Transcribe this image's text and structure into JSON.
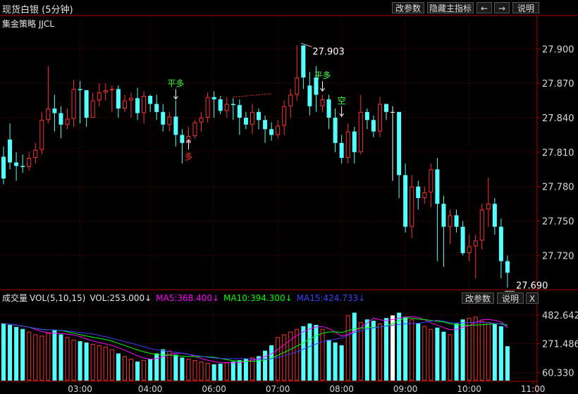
{
  "header": {
    "title": "现货白银 (5分钟)",
    "subtitle": "集金策略 JJCL",
    "buttons": {
      "params": "改参数",
      "hide": "隐藏主指标",
      "left": "←",
      "right": "→",
      "help": "说明"
    }
  },
  "volume_panel": {
    "name": "成交量",
    "indicator": "VOL(5,10,15)",
    "vol": "VOL:253.000↓",
    "ma5": "MA5:368.400↓",
    "ma10": "MA10:394.300↓",
    "ma15": "MA15:424.733↓",
    "buttons": {
      "params": "改参数",
      "help": "说明",
      "close": "X"
    }
  },
  "colors": {
    "up": "#ff3232",
    "down": "#54ffff",
    "doji": "#ffffff",
    "ma5": "#ff00ff",
    "ma10": "#00ff00",
    "ma15": "#4040ff",
    "grid": "#7a0000",
    "axis_text": "#d8d8d8",
    "signal_green": "#3cff3c",
    "signal_red": "#ff3232"
  },
  "chart_data": [
    {
      "type": "candlestick",
      "price_ticks": [
        "27.900",
        "27.870",
        "27.840",
        "27.810",
        "27.780",
        "27.750",
        "27.720"
      ],
      "ylim": [
        27.692,
        27.918
      ],
      "annotations": [
        {
          "label": "27.903",
          "kind": "high",
          "index": 47,
          "price": 27.903
        },
        {
          "label": "27.690",
          "kind": "low",
          "index": 79,
          "price": 27.69
        }
      ],
      "signals": [
        {
          "text": "平多",
          "index": 27,
          "price": 27.855,
          "dir": "down",
          "color": "green"
        },
        {
          "text": "多",
          "index": 29,
          "price": 27.822,
          "dir": "up",
          "color": "red"
        },
        {
          "text": "平多",
          "index": 50,
          "price": 27.862,
          "dir": "down",
          "color": "green"
        },
        {
          "text": "空",
          "index": 53,
          "price": 27.84,
          "dir": "down",
          "color": "green"
        }
      ],
      "opens": [
        27.806,
        27.821,
        27.801,
        27.798,
        27.797,
        27.805,
        27.812,
        27.838,
        27.848,
        27.844,
        27.834,
        27.839,
        27.865,
        27.864,
        27.84,
        27.855,
        27.862,
        27.864,
        27.865,
        27.848,
        27.855,
        27.857,
        27.844,
        27.859,
        27.852,
        27.845,
        27.834,
        27.841,
        27.825,
        27.818,
        27.824,
        27.836,
        27.84,
        27.858,
        27.856,
        27.846,
        27.852,
        27.851,
        27.84,
        27.834,
        27.845,
        27.838,
        27.83,
        27.825,
        27.833,
        27.85,
        27.86,
        27.903,
        27.868,
        27.875,
        27.85,
        27.856,
        27.84,
        27.818,
        27.805,
        27.828,
        27.81,
        27.845,
        27.838,
        27.828,
        27.852,
        27.845,
        27.845,
        27.79,
        27.745,
        27.78,
        27.77,
        27.775,
        27.795,
        27.765,
        27.745,
        27.755,
        27.745,
        27.722,
        27.728,
        27.733,
        27.76,
        27.765,
        27.745,
        27.715
      ],
      "closes": [
        27.787,
        27.801,
        27.798,
        27.797,
        27.805,
        27.812,
        27.838,
        27.848,
        27.844,
        27.834,
        27.839,
        27.865,
        27.864,
        27.84,
        27.855,
        27.862,
        27.864,
        27.865,
        27.848,
        27.855,
        27.857,
        27.844,
        27.859,
        27.852,
        27.845,
        27.834,
        27.841,
        27.825,
        27.818,
        27.824,
        27.836,
        27.84,
        27.858,
        27.856,
        27.846,
        27.852,
        27.851,
        27.84,
        27.834,
        27.845,
        27.838,
        27.83,
        27.825,
        27.833,
        27.85,
        27.86,
        27.875,
        27.875,
        27.85,
        27.86,
        27.856,
        27.84,
        27.818,
        27.805,
        27.828,
        27.81,
        27.845,
        27.838,
        27.828,
        27.852,
        27.845,
        27.845,
        27.79,
        27.745,
        27.78,
        27.77,
        27.775,
        27.795,
        27.765,
        27.745,
        27.755,
        27.745,
        27.722,
        27.728,
        27.733,
        27.76,
        27.765,
        27.745,
        27.715,
        27.705
      ],
      "highs": [
        27.815,
        27.835,
        27.81,
        27.808,
        27.81,
        27.818,
        27.845,
        27.885,
        27.86,
        27.85,
        27.848,
        27.873,
        27.872,
        27.862,
        27.862,
        27.87,
        27.87,
        27.868,
        27.868,
        27.86,
        27.862,
        27.866,
        27.863,
        27.86,
        27.86,
        27.852,
        27.845,
        27.855,
        27.83,
        27.832,
        27.838,
        27.845,
        27.862,
        27.863,
        27.859,
        27.858,
        27.857,
        27.856,
        27.845,
        27.852,
        27.848,
        27.842,
        27.836,
        27.838,
        27.855,
        27.865,
        27.903,
        27.89,
        27.88,
        27.885,
        27.86,
        27.86,
        27.848,
        27.825,
        27.835,
        27.832,
        27.86,
        27.848,
        27.842,
        27.858,
        27.85,
        27.85,
        27.845,
        27.8,
        27.79,
        27.785,
        27.78,
        27.8,
        27.805,
        27.772,
        27.76,
        27.76,
        27.75,
        27.738,
        27.738,
        27.765,
        27.788,
        27.77,
        27.752,
        27.72
      ],
      "lows": [
        27.782,
        27.795,
        27.785,
        27.792,
        27.794,
        27.8,
        27.808,
        27.835,
        27.828,
        27.822,
        27.83,
        27.832,
        27.835,
        27.832,
        27.84,
        27.85,
        27.855,
        27.845,
        27.84,
        27.845,
        27.84,
        27.838,
        27.835,
        27.845,
        27.838,
        27.828,
        27.828,
        27.815,
        27.8,
        27.815,
        27.822,
        27.828,
        27.836,
        27.84,
        27.843,
        27.84,
        27.838,
        27.825,
        27.83,
        27.826,
        27.83,
        27.818,
        27.82,
        27.822,
        27.825,
        27.84,
        27.855,
        27.865,
        27.842,
        27.845,
        27.845,
        27.83,
        27.81,
        27.8,
        27.8,
        27.8,
        27.808,
        27.83,
        27.823,
        27.823,
        27.838,
        27.785,
        27.77,
        27.74,
        27.735,
        27.76,
        27.765,
        27.762,
        27.715,
        27.71,
        27.73,
        27.74,
        27.72,
        27.715,
        27.7,
        27.725,
        27.745,
        27.738,
        27.7,
        27.692
      ]
    },
    {
      "type": "bar",
      "name": "VOL(5,10,15)",
      "value_ticks": [
        "482.642",
        "271.486",
        "60.330"
      ],
      "ylim": [
        0,
        560
      ],
      "x_ticks": [
        {
          "label": "03:00",
          "index": 12
        },
        {
          "label": "04:00",
          "index": 23
        },
        {
          "label": "06:00",
          "index": 33
        },
        {
          "label": "07:00",
          "index": 43
        },
        {
          "label": "08:00",
          "index": 53
        },
        {
          "label": "09:00",
          "index": 63
        },
        {
          "label": "10:00",
          "index": 73
        },
        {
          "label": "11:00",
          "index": 83
        }
      ],
      "values": [
        420,
        410,
        395,
        380,
        360,
        340,
        330,
        350,
        370,
        340,
        320,
        300,
        290,
        280,
        270,
        260,
        250,
        230,
        200,
        180,
        160,
        140,
        150,
        160,
        200,
        230,
        220,
        190,
        170,
        160,
        150,
        140,
        130,
        120,
        125,
        135,
        140,
        150,
        160,
        170,
        180,
        220,
        260,
        320,
        340,
        360,
        380,
        400,
        420,
        410,
        380,
        300,
        280,
        260,
        480,
        500,
        430,
        450,
        440,
        420,
        460,
        480,
        500,
        470,
        450,
        420,
        400,
        380,
        390,
        360,
        340,
        420,
        450,
        460,
        470,
        440,
        430,
        420,
        400,
        253
      ]
    }
  ]
}
